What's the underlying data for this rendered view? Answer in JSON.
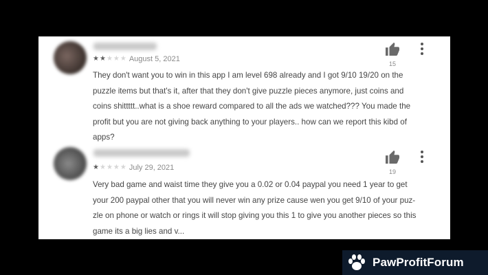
{
  "reviews": [
    {
      "reviewer_name": "",
      "rating": 2,
      "max_rating": 5,
      "date": "August 5, 2021",
      "helpful_count": "15",
      "lines": [
        "They don't want you to win in this app I am level 698 already and I got 9/10 19/20 on the",
        "puzzle items but that's it, after that they don't give puzzle pieces anymore, just coins and",
        "coins shittttt..what is a shoe reward compared to all the ads we watched??? You made the",
        "profit but you are not giving back anything to your players.. how can we report this kibd of",
        "apps?"
      ]
    },
    {
      "reviewer_name": "",
      "rating": 1,
      "max_rating": 5,
      "date": "July 29, 2021",
      "helpful_count": "19",
      "lines": [
        "Very bad game and waist time they give you a 0.02 or 0.04 paypal you need 1 year to get",
        "your 200 paypal other that you will never win any prize cause wen you get 9/10 of your puz-",
        "zle on phone or watch or rings it will stop giving you this 1 to give you another pieces so this",
        "game its a big lies and v..."
      ]
    }
  ],
  "icons": {
    "helpful": "thumbs-up-icon",
    "more": "more-vertical-icon",
    "brand": "paw-icon"
  },
  "brand": {
    "name": "PawProfitForum"
  },
  "colors": {
    "background": "#000000",
    "card": "#ffffff",
    "text": "#454545",
    "brand_bg": "#0e1b2c"
  }
}
